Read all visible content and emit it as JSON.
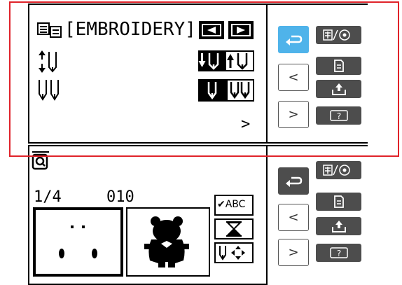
{
  "top_panel": {
    "mode_label": "[EMBROIDERY]",
    "next_arrow": ">",
    "icons": [
      "embroidery-mode-icon",
      "prev-arrow-icon",
      "next-arrow-icon",
      "needle-up-down-icon",
      "needle-down-selected-icon",
      "needle-up-icon",
      "twin-needle-icon",
      "single-needle-selected-icon",
      "twin-needle-button-icon"
    ]
  },
  "bottom_panel": {
    "page_indicator": "1/4",
    "pattern_number": "010",
    "check_label": "✔ABC",
    "icons": [
      "search-icon",
      "hourglass-icon",
      "move-icon"
    ]
  },
  "sidebar": {
    "prev_label": "<",
    "next_label": ">",
    "icons": [
      "back-icon",
      "language-settings-icon",
      "document-icon",
      "memory-icon",
      "help-icon"
    ]
  },
  "colors": {
    "accent": "#4fb3ea",
    "dark_button": "#4d4d4d",
    "highlight": "#e0232a"
  }
}
